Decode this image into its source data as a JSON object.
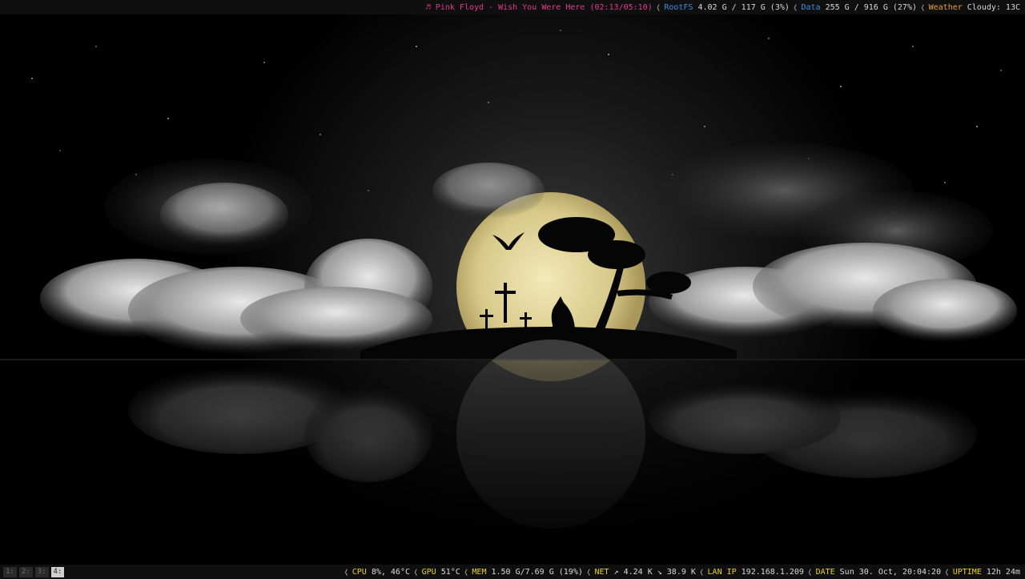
{
  "top_bar": {
    "music_icon": "♬",
    "music": "Pink Floyd - Wish You Were Here (02:13/05:10)",
    "rootfs_label": "RootFS",
    "rootfs_value": "4.02 G / 117 G (3%)",
    "data_label": "Data",
    "data_value": "255 G / 916 G (27%)",
    "weather_label": "Weather",
    "weather_value": "Cloudy: 13C"
  },
  "bottom_bar": {
    "workspaces": [
      "1:",
      "2:",
      "3:",
      "4:"
    ],
    "active_workspace": 4,
    "cpu_label": "CPU",
    "cpu_value": "8%,  46°C",
    "gpu_label": "GPU",
    "gpu_value": "51°C",
    "mem_label": "MEM",
    "mem_value": "1.50 G/7.69 G (19%)",
    "net_label": "NET",
    "net_value": "↗ 4.24 K ↘ 38.9 K",
    "lan_label": "LAN IP",
    "lan_value": "192.168.1.209",
    "date_label": "DATE",
    "date_value": "Sun 30. Oct, 20:04:20",
    "uptime_label": "UPTIME",
    "uptime_value": "12h 24m"
  },
  "colors": {
    "music": "#e23a8e",
    "disk": "#3d8ee0",
    "weather": "#e7a13b",
    "system": "#e8d21d",
    "bar_bg": "#0f0f0f"
  },
  "icons": [
    "music-note-icon",
    "separator-chevron-icon",
    "net-up-arrow-icon",
    "net-down-arrow-icon"
  ]
}
